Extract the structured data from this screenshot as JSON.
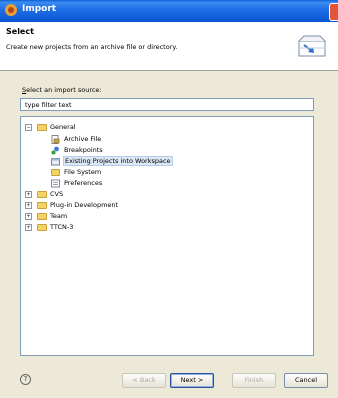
{
  "window": {
    "title": "Import"
  },
  "header": {
    "title": "Select",
    "description": "Create new projects from an archive file or directory."
  },
  "source": {
    "label_accel": "S",
    "label_rest": "elect an import source:",
    "filter_text": "type filter text"
  },
  "tree": {
    "general": "General",
    "archive_file": "Archive File",
    "breakpoints": "Breakpoints",
    "existing_projects": "Existing Projects into Workspace",
    "file_system": "File System",
    "preferences": "Preferences",
    "cvs": "CVS",
    "plugin_dev": "Plug-in Development",
    "team": "Team",
    "ttcn3": "TTCN-3"
  },
  "buttons": {
    "back": "< Back",
    "next": "Next >",
    "finish": "Finish",
    "cancel": "Cancel"
  },
  "icons": {
    "help": "?"
  }
}
